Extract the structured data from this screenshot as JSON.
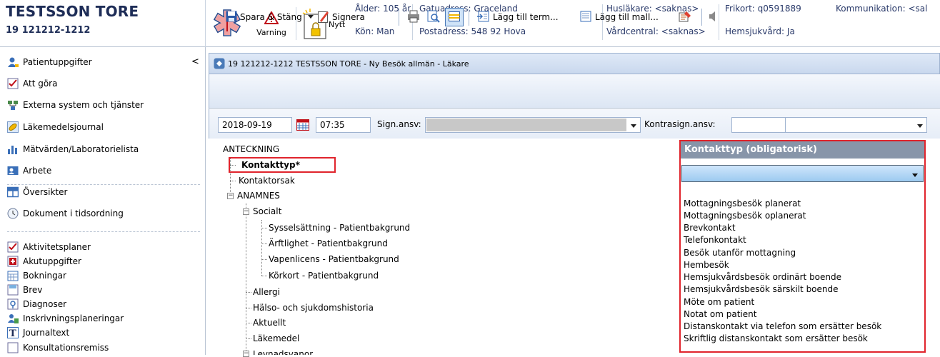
{
  "patient": {
    "name": "TESTSSON TORE",
    "id": "19 121212-1212"
  },
  "header_buttons": {
    "warning_label": "Varning",
    "new_label": "Nytt"
  },
  "header_fields": {
    "age_label": "Ålder:",
    "age_value": "105 år",
    "gender_label": "Kön:",
    "gender_value": "Man",
    "street_label": "Gatuadress:",
    "street_value": "Graceland",
    "postal_label": "Postadress:",
    "postal_value": "548 92 Hova",
    "doctor_label": "Husläkare:",
    "doctor_value": "<saknas>",
    "care_center_label": "Vårdcentral:",
    "care_center_value": "<saknas>",
    "frikort_label": "Frikort:",
    "frikort_value": "q0591889",
    "home_care_label": "Hemsjukvård:",
    "home_care_value": "Ja",
    "communication_label": "Kommunikation:",
    "communication_value": "<sal"
  },
  "sidebar": {
    "collapse_glyph": "<",
    "items": [
      {
        "label": "Patientuppgifter",
        "icon": "person-icon"
      },
      {
        "label": "Att göra",
        "icon": "checklist-icon"
      },
      {
        "label": "Externa system och tjänster",
        "icon": "network-icon"
      },
      {
        "label": "Läkemedelsjournal",
        "icon": "medication-icon"
      },
      {
        "label": "Mätvärden/Laboratorielista",
        "icon": "chart-icon"
      },
      {
        "label": "Arbete",
        "icon": "work-icon"
      },
      {
        "label": "Översikter",
        "icon": "overview-icon"
      },
      {
        "label": "Dokument i tidsordning",
        "icon": "document-icon"
      }
    ],
    "sub_items": [
      {
        "label": "Aktivitetsplaner",
        "icon": "activity-icon"
      },
      {
        "label": "Akutuppgifter",
        "icon": "emergency-icon"
      },
      {
        "label": "Bokningar",
        "icon": "booking-icon"
      },
      {
        "label": "Brev",
        "icon": "letter-icon"
      },
      {
        "label": "Diagnoser",
        "icon": "diagnosis-icon"
      },
      {
        "label": "Inskrivningsplaneringar",
        "icon": "admission-icon"
      },
      {
        "label": "Journaltext",
        "icon": "journal-icon"
      },
      {
        "label": "Konsultationsremiss",
        "icon": "referral-icon"
      }
    ]
  },
  "document": {
    "title": "19 121212-1212 TESTSSON TORE - Ny Besök allmän - Läkare"
  },
  "toolbar": {
    "save_close": "Spara & Stäng",
    "sign": "Signera",
    "add_term": "Lägg till term...",
    "add_template": "Lägg till mall..."
  },
  "form": {
    "date": "2018-09-19",
    "time": "07:35",
    "sign_label": "Sign.ansv:",
    "sign_value": "",
    "contrasign_label": "Kontrasign.ansv:",
    "contrasign_value": ""
  },
  "tree": {
    "root": "ANTECKNING",
    "kontakttyp": "Kontakttyp*",
    "kontaktorsak": "Kontaktorsak",
    "anamnes": "ANAMNES",
    "socialt": "Socialt",
    "socialt_children": [
      "Sysselsättning - Patientbakgrund",
      "Ärftlighet - Patientbakgrund",
      "Vapenlicens - Patientbakgrund",
      "Körkort - Patientbakgrund"
    ],
    "anamnes_children": [
      "Allergi",
      "Hälso- och sjukdomshistoria",
      "Aktuellt",
      "Läkemedel"
    ],
    "levnadsvanor": "Levnadsvanor"
  },
  "kontakttyp_panel": {
    "title": "Kontakttyp  (obligatorisk)",
    "selected": "",
    "options": [
      "Mottagningsbesök planerat",
      "Mottagningsbesök oplanerat",
      "Brevkontakt",
      "Telefonkontakt",
      "Besök utanför mottagning",
      "Hembesök",
      "Hemsjukvårdsbesök ordinärt boende",
      "Hemsjukvårdsbesök särskilt boende",
      "Möte om patient",
      "Notat om patient",
      "Distanskontakt via telefon som ersätter besök",
      "Skriftlig distanskontakt som ersätter besök"
    ]
  },
  "colors": {
    "highlight_red": "#e0242c",
    "panel_header": "#8795a9",
    "header_text": "#1e2d57"
  }
}
